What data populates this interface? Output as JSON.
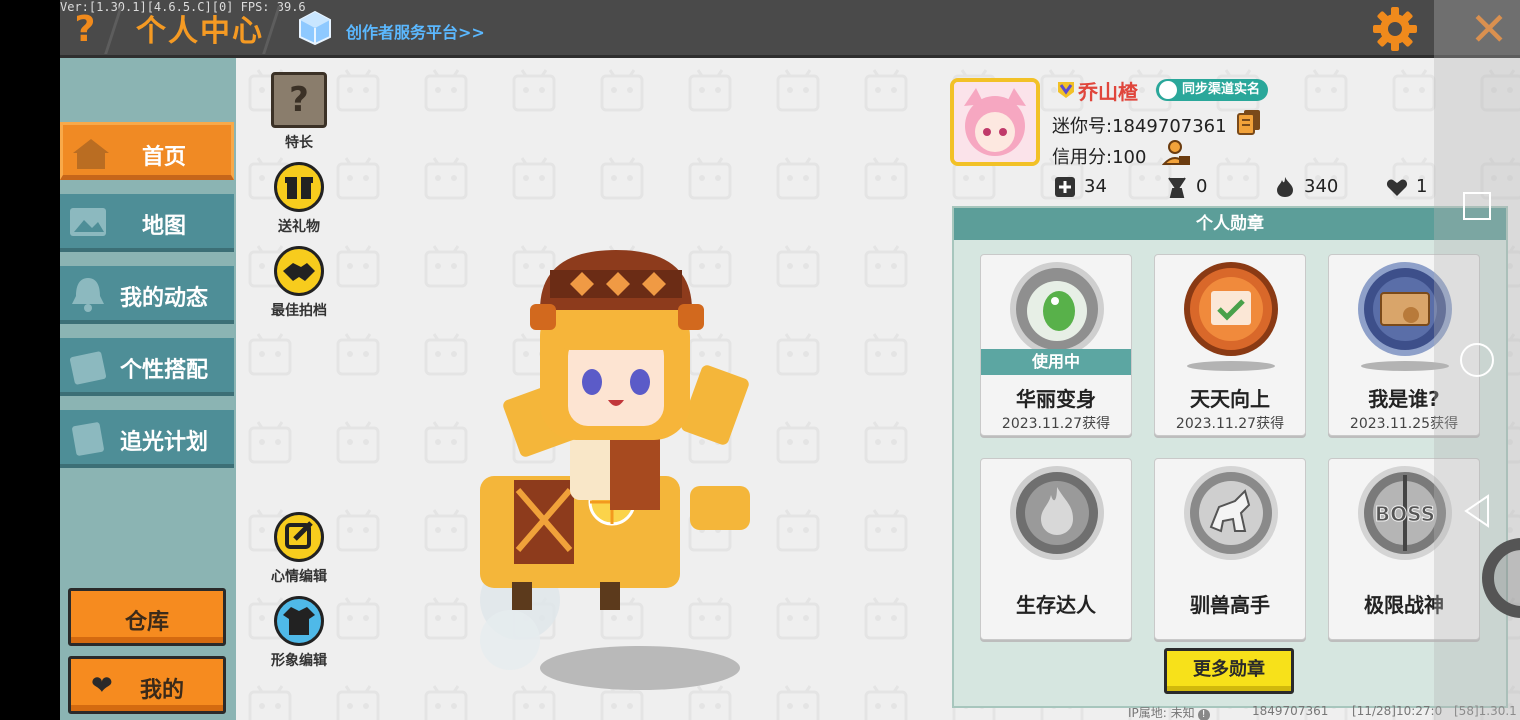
{
  "header": {
    "version": "Ver:[1.30.1][4.6.5.C][0] FPS: 39.6",
    "help": "?",
    "title": "个人中心",
    "creator_link": "创作者服务平台>>",
    "close": "✕"
  },
  "sidebar": {
    "items": [
      {
        "label": "首页",
        "active": true,
        "icon": "house-icon"
      },
      {
        "label": "地图",
        "active": false,
        "icon": "map-icon"
      },
      {
        "label": "我的动态",
        "active": false,
        "icon": "bell-icon"
      },
      {
        "label": "个性搭配",
        "active": false,
        "icon": "outfit-icon"
      },
      {
        "label": "追光计划",
        "active": false,
        "icon": "plan-icon"
      }
    ],
    "warehouse": "仓库",
    "mine": "我的",
    "mine_heart": "❤"
  },
  "actions": {
    "specialty": "特长",
    "specialty_glyph": "?",
    "gift": "送礼物",
    "partner": "最佳拍档",
    "mood_edit": "心情编辑",
    "avatar_edit": "形象编辑"
  },
  "profile": {
    "username": "乔山楂",
    "verify_badge": "同步渠道实名",
    "mini_id": "迷你号:1849707361",
    "credit": "信用分:100",
    "stats": {
      "posts": "34",
      "fans": "0",
      "popularity": "340",
      "likes": "1"
    }
  },
  "medals": {
    "title": "个人勋章",
    "using_label": "使用中",
    "items": [
      {
        "name": "华丽变身",
        "date": "2023.11.27获得",
        "in_use": true
      },
      {
        "name": "天天向上",
        "date": "2023.11.27获得",
        "in_use": false
      },
      {
        "name": "我是谁?",
        "date": "2023.11.25获得",
        "in_use": false
      },
      {
        "name": "生存达人",
        "date": "",
        "in_use": false
      },
      {
        "name": "驯兽高手",
        "date": "",
        "in_use": false
      },
      {
        "name": "极限战神",
        "date": "",
        "in_use": false
      }
    ],
    "more_button": "更多勋章"
  },
  "footer": {
    "ip": "IP属地: 未知",
    "uid": "1849707361",
    "time": "[11/28]10:27:0",
    "build": "[58]1.30.1"
  },
  "colors": {
    "accent_orange": "#f08a24",
    "teal": "#4e8e97",
    "medal_header": "#5c9e99",
    "username_red": "#e0463c",
    "link_blue": "#5bb8ff"
  }
}
